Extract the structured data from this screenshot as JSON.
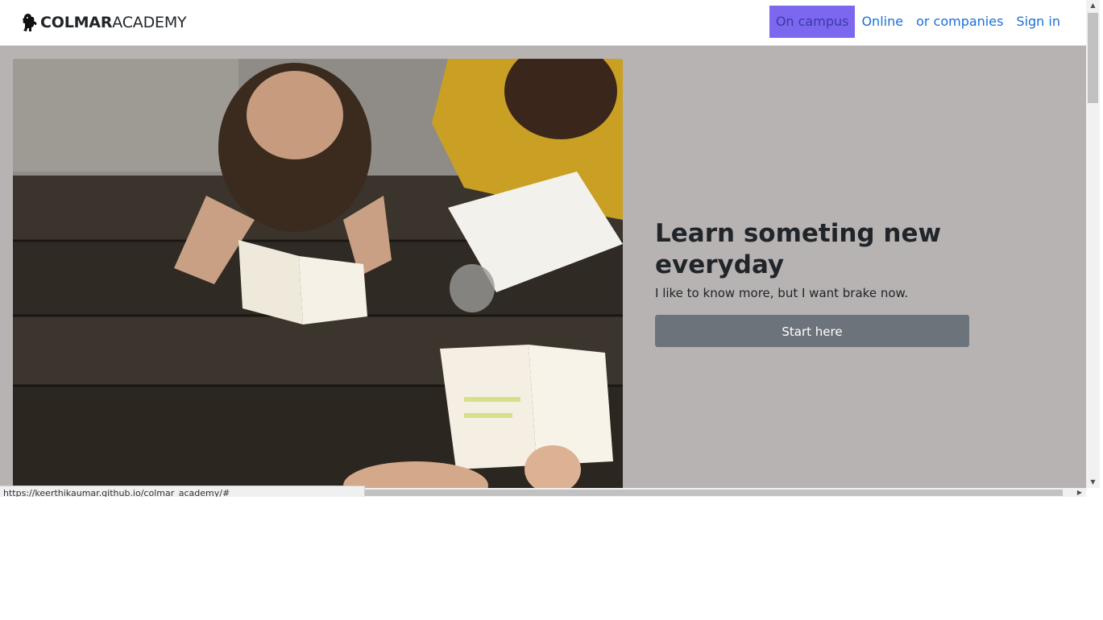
{
  "brand": {
    "bold": "COLMAR",
    "light": "ACADEMY",
    "icon": "lion-icon"
  },
  "nav": {
    "items": [
      {
        "label": "On campus",
        "active": true
      },
      {
        "label": "Online",
        "active": false
      },
      {
        "label": "or companies",
        "active": false
      },
      {
        "label": "Sign in",
        "active": false
      }
    ]
  },
  "hero": {
    "title": "Learn someting new everyday",
    "subtitle": "I like to know more, but I want brake now.",
    "cta_label": "Start here",
    "image": "photo of people reading books at a wooden table"
  },
  "status": {
    "url": "https://keerthikaumar.github.io/colmar_academy/#"
  },
  "colors": {
    "hero_bg": "#b8b3b3",
    "nav_active_bg": "#7b68ee",
    "link": "#1a6fd8",
    "cta_bg": "#6c737a"
  }
}
